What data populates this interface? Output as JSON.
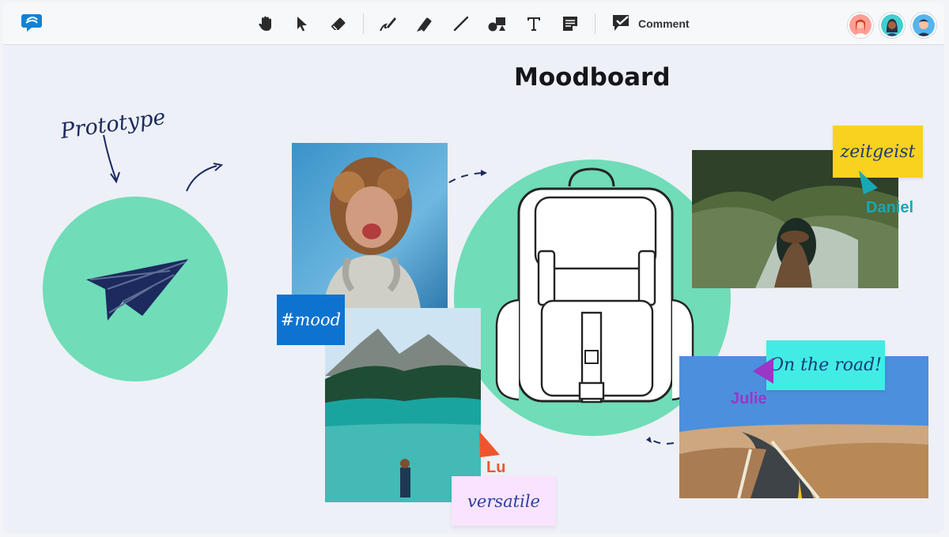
{
  "app": {
    "title": "Moodboard"
  },
  "toolbar": {
    "comment_label": "Comment",
    "tools": [
      "hand-icon",
      "pointer-icon",
      "eraser-icon",
      "pen-icon",
      "marker-icon",
      "line-icon",
      "shapes-icon",
      "text-icon",
      "note-icon"
    ]
  },
  "canvas": {
    "prototype_label": "Prototype",
    "tag_label": "#mood",
    "sticky_notes": [
      {
        "text": "zeitgeist",
        "color": "#f8d21e"
      },
      {
        "text": "On the road!",
        "color": "#42ece4"
      },
      {
        "text": "versatile",
        "color": "#f9e3ff"
      }
    ],
    "collaborators": [
      {
        "name": "Daniel",
        "color": "#18a8b3"
      },
      {
        "name": "Julie",
        "color": "#9b36c6"
      },
      {
        "name": "Lu",
        "color": "#ef552d"
      }
    ]
  },
  "colors": {
    "mint": "#70dcb8",
    "ink": "#1c2a5a"
  }
}
